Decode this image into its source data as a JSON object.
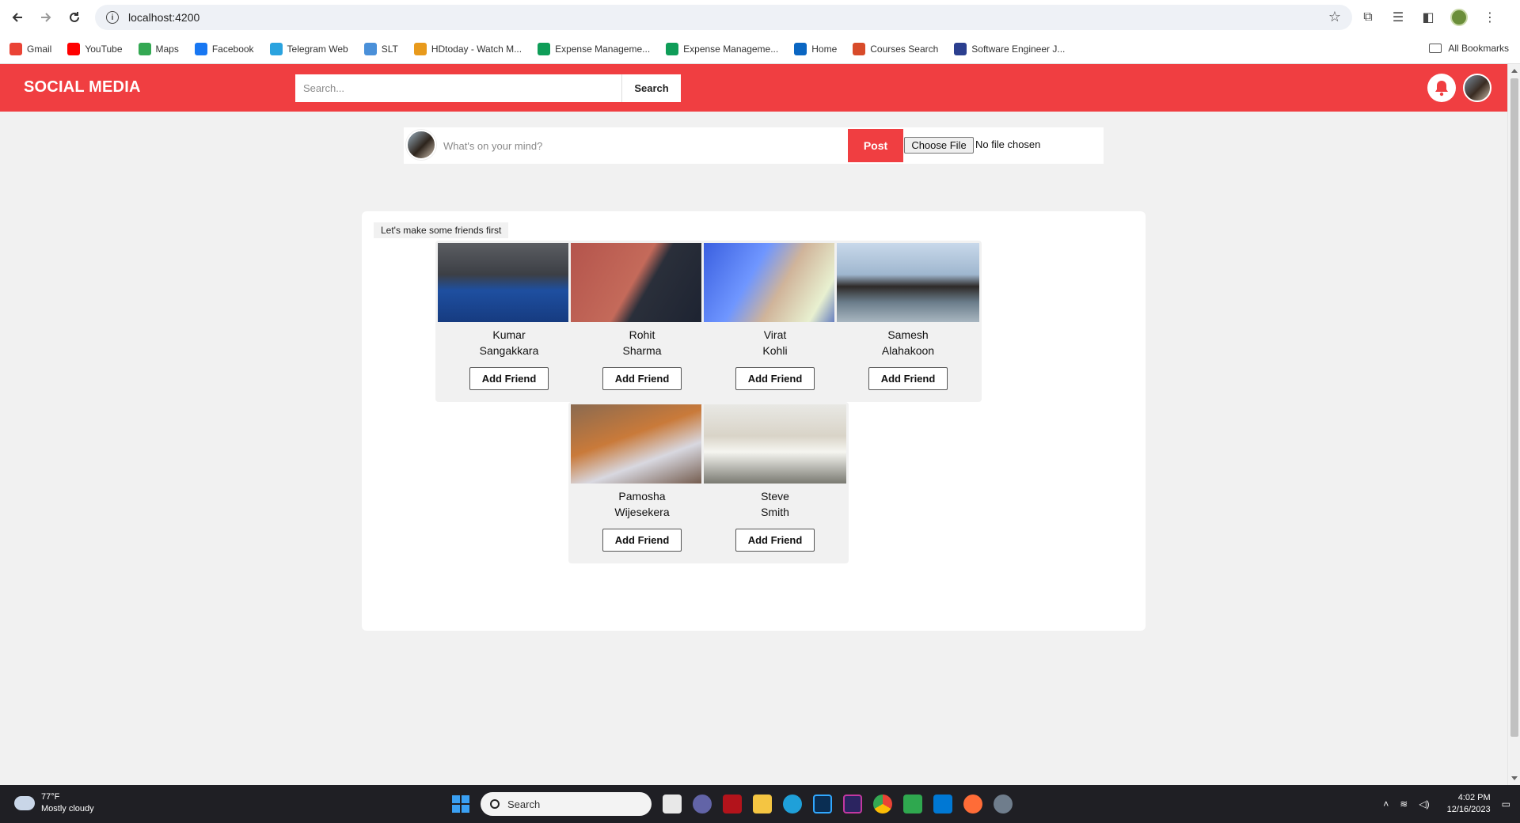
{
  "browser": {
    "url": "localhost:4200",
    "bookmarks": [
      {
        "label": "Gmail",
        "icon": "gmail-icon",
        "color": "#ea4335"
      },
      {
        "label": "YouTube",
        "icon": "youtube-icon",
        "color": "#ff0000"
      },
      {
        "label": "Maps",
        "icon": "maps-icon",
        "color": "#34a853"
      },
      {
        "label": "Facebook",
        "icon": "facebook-icon",
        "color": "#1877f2"
      },
      {
        "label": "Telegram Web",
        "icon": "telegram-icon",
        "color": "#2aa3df"
      },
      {
        "label": "SLT",
        "icon": "slt-icon",
        "color": "#4a90d9"
      },
      {
        "label": "HDtoday - Watch M...",
        "icon": "hdtoday-icon",
        "color": "#e89a1c"
      },
      {
        "label": "Expense Manageme...",
        "icon": "sheets-icon",
        "color": "#0f9d58"
      },
      {
        "label": "Expense Manageme...",
        "icon": "sheets-icon",
        "color": "#0f9d58"
      },
      {
        "label": "Home",
        "icon": "linkedin-icon",
        "color": "#0a66c2"
      },
      {
        "label": "Courses Search",
        "icon": "courses-icon",
        "color": "#d84b2a"
      },
      {
        "label": "Software Engineer J...",
        "icon": "globe-icon",
        "color": "#2b3f8f"
      }
    ],
    "all_bookmarks_label": "All Bookmarks"
  },
  "header": {
    "logo": "SOCIAL MEDIA",
    "search_placeholder": "Search...",
    "search_button": "Search",
    "accent_color": "#f03e41"
  },
  "composer": {
    "placeholder": "What's on your mind?",
    "post_button": "Post",
    "file_button": "Choose File",
    "file_status": "No file chosen"
  },
  "friends": {
    "heading": "Let's make some friends first",
    "button_label": "Add Friend",
    "suggestions": [
      {
        "first": "Kumar",
        "last": "Sangakkara"
      },
      {
        "first": "Rohit",
        "last": "Sharma"
      },
      {
        "first": "Virat",
        "last": "Kohli"
      },
      {
        "first": "Samesh",
        "last": "Alahakoon"
      },
      {
        "first": "Pamosha",
        "last": "Wijesekera"
      },
      {
        "first": "Steve",
        "last": "Smith"
      }
    ]
  },
  "taskbar": {
    "temperature": "77°F",
    "weather": "Mostly cloudy",
    "search_label": "Search",
    "time": "4:02 PM",
    "date": "12/16/2023"
  }
}
